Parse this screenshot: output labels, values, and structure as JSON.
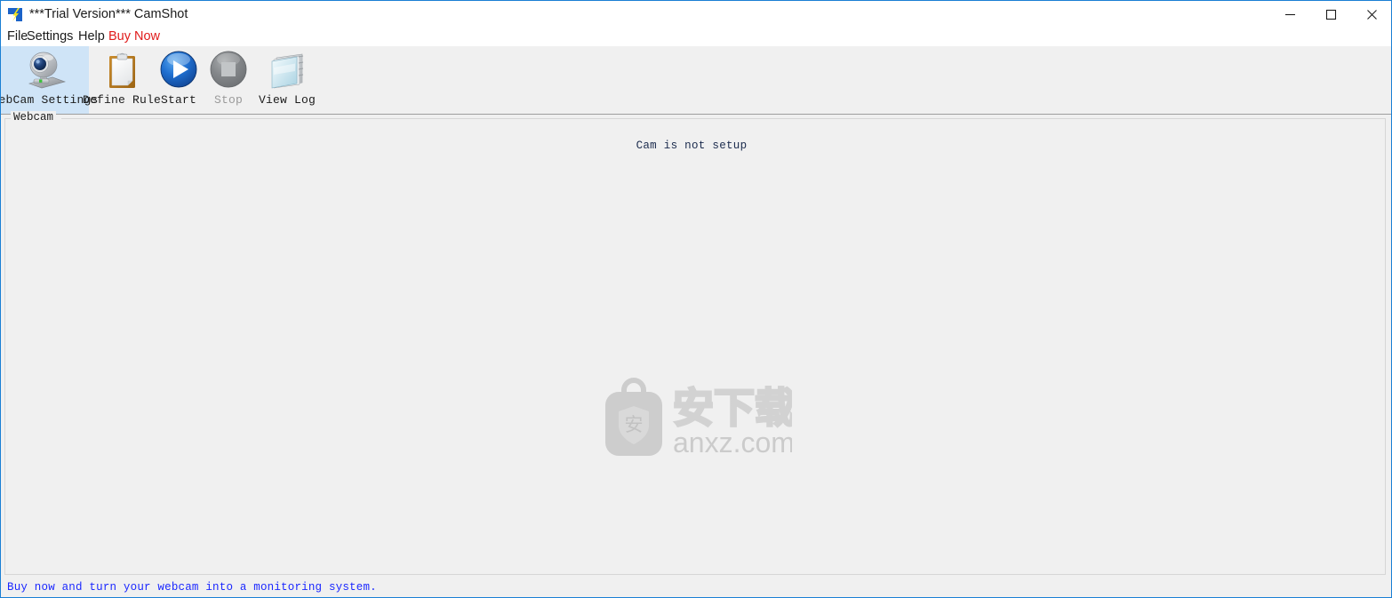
{
  "window": {
    "title": "***Trial Version*** CamShot",
    "app_icon": "lightning-bolt-icon",
    "border_color": "#1a7fd4",
    "controls": {
      "minimize": "minimize-icon",
      "maximize": "maximize-icon",
      "close": "close-icon"
    }
  },
  "menubar": {
    "items": [
      {
        "label": "File"
      },
      {
        "label": "Settings"
      },
      {
        "label": "Help"
      },
      {
        "label": "Buy Now",
        "color": "#e01b1b"
      }
    ]
  },
  "toolbar": {
    "selected_index": 0,
    "selected_color": "#cfe4f7",
    "buttons": [
      {
        "label": "WebCam Settings",
        "icon": "webcam-icon",
        "enabled": true,
        "selected": true
      },
      {
        "label": "Define Rule",
        "icon": "clipboard-icon",
        "enabled": true,
        "selected": false
      },
      {
        "label": "Start",
        "icon": "play-icon",
        "enabled": true,
        "selected": false
      },
      {
        "label": "Stop",
        "icon": "stop-icon",
        "enabled": false,
        "selected": false
      },
      {
        "label": "View Log",
        "icon": "notepad-icon",
        "enabled": true,
        "selected": false
      }
    ]
  },
  "content": {
    "groupbox_label": "Webcam",
    "cam_status": "Cam is not setup"
  },
  "watermark": {
    "logo": "shield-bag-icon",
    "shield_char": "安",
    "chinese_text": "安下载",
    "domain_text": "anxz.com",
    "color": "#cfcfcf"
  },
  "statusbar": {
    "message": "Buy now and turn your webcam into a monitoring system.",
    "color": "#1b28ff"
  }
}
